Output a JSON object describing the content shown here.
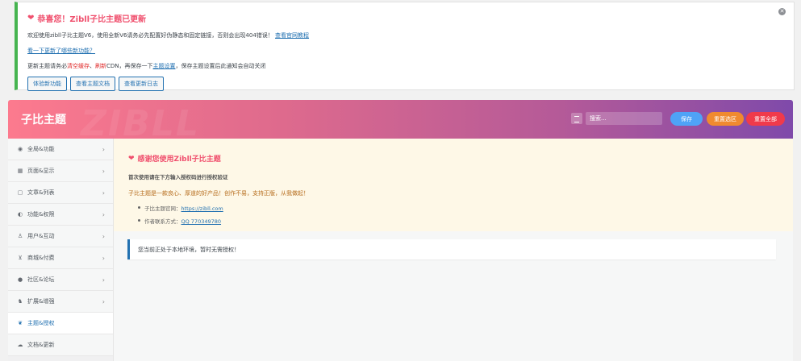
{
  "notice": {
    "title": "恭喜您！Zibll子比主题已更新",
    "line1_text": "欢迎使用zibll子比主题V6，使用全新V6请务必先配置好伪静态和固定链接，否则会出现404错误！",
    "line1_link": "查看官网教程",
    "line2_link": "看一下更新了哪些新功能？",
    "line3_a": "更新主题请务必",
    "line3_b": "清空缓存",
    "line3_c": "、",
    "line3_d": "刷新",
    "line3_e": "CDN",
    "line3_f": "，再保存一下",
    "line3_g": "主题设置",
    "line3_h": "，保存主题设置后此通知会自动关闭",
    "buttons": [
      "体验新功能",
      "查看主题文档",
      "查看更新日志"
    ],
    "close_icon": "close-icon"
  },
  "header": {
    "brand": "子比主题",
    "watermark": "ZIBLL",
    "search_placeholder": "搜索...",
    "save_label": "保存",
    "reset_selected_label": "重置选区",
    "reset_all_label": "重置全部"
  },
  "sidebar": {
    "items": [
      {
        "label": "全局&功能",
        "icon": "◉",
        "icon_name": "globe-icon"
      },
      {
        "label": "页面&显示",
        "icon": "▦",
        "icon_name": "calendar-icon"
      },
      {
        "label": "文章&列表",
        "icon": "▢",
        "icon_name": "book-icon"
      },
      {
        "label": "功能&权限",
        "icon": "◐",
        "icon_name": "shield-icon"
      },
      {
        "label": "用户&互动",
        "icon": "♙",
        "icon_name": "user-icon"
      },
      {
        "label": "商城&付费",
        "icon": "⊻",
        "icon_name": "cart-icon"
      },
      {
        "label": "社区&论坛",
        "icon": "●",
        "icon_name": "community-icon"
      },
      {
        "label": "扩展&增强",
        "icon": "♞",
        "icon_name": "puzzle-icon"
      },
      {
        "label": "主题&授权",
        "icon": "❦",
        "icon_name": "authorize-icon"
      },
      {
        "label": "文档&更新",
        "icon": "☁",
        "icon_name": "cloud-icon"
      }
    ],
    "chevron": "›"
  },
  "main": {
    "title": "感谢您使用Zibll子比主题",
    "subtitle": "首次使用请在下方输入授权码进行授权验证",
    "desc": "子比主题是一款良心、厚道的好产品！创作不易，支持正版，从我做起！",
    "site_label": "子比主题官网：",
    "site_link": "https://zibll.com",
    "contact_label": "作者联系方式：",
    "contact_link": "QQ 770349780",
    "info": "您当前正处于本地环境，暂时无需授权！"
  },
  "colors": {
    "accent": "#2271b1",
    "title_pink": "#f0506e",
    "save": "#4fa3f7",
    "reset_selected": "#f08a2f",
    "reset_all": "#f03a4b"
  }
}
